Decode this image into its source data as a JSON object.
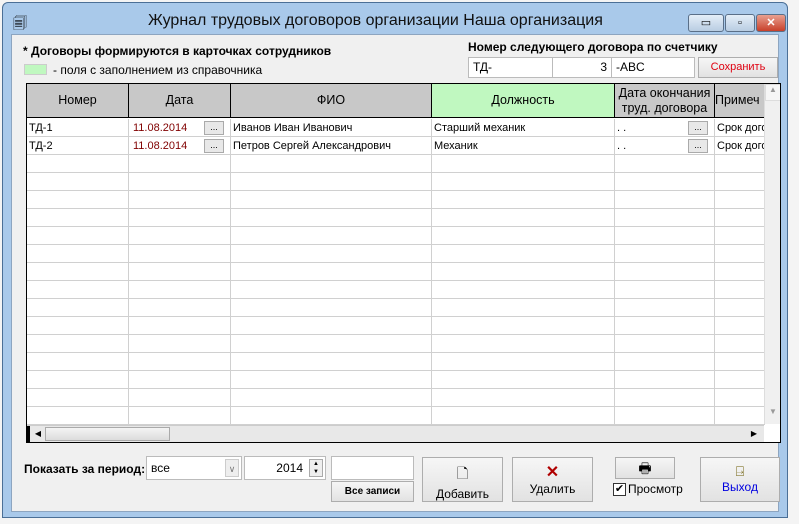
{
  "window": {
    "title": "Журнал трудовых договоров организации  Наша организация",
    "minimize": "▭",
    "maximize": "▫",
    "close": "✕"
  },
  "notes": {
    "line1": "* Договоры формируются в карточках сотрудников",
    "legend": "- поля с заполнением из справочника",
    "legend_color": "#c0f8c0"
  },
  "counter": {
    "label": "Номер следующего договора по счетчику",
    "prefix": "ТД-",
    "number": "3",
    "suffix": "-ABC",
    "save": "Сохранить"
  },
  "table": {
    "headers": [
      "Номер",
      "Дата",
      "ФИО",
      "Должность",
      "Дата окончания труд. договора",
      "Примеч"
    ],
    "rows": [
      {
        "num": "ТД-1",
        "date": "11.08.2014",
        "fio": "Иванов Иван Иванович",
        "pos": "Старший механик",
        "end": " .  .",
        "note": "Срок договора"
      },
      {
        "num": "ТД-2",
        "date": "11.08.2014",
        "fio": "Петров Сергей Александрович",
        "pos": "Механик",
        "end": " .  .",
        "note": "Срок договора"
      }
    ],
    "dots": "..."
  },
  "footer": {
    "period_label": "Показать за период:",
    "period_value": "все",
    "year": "2014",
    "all_records": "Все записи",
    "add": "Добавить",
    "delete": "Удалить",
    "preview": "Просмотр",
    "preview_checked": true,
    "exit": "Выход"
  }
}
